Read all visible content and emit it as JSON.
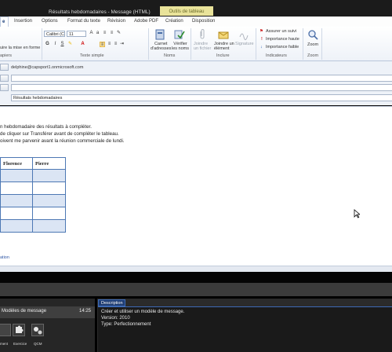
{
  "window": {
    "title": "Résultats hebdomadaires - Message (HTML)",
    "tools_tab": "Outils de tableau"
  },
  "tabs": [
    {
      "label": "e",
      "active": true
    },
    {
      "label": "Insertion"
    },
    {
      "label": "Options"
    },
    {
      "label": "Format du texte"
    },
    {
      "label": "Révision"
    },
    {
      "label": "Adobe PDF"
    },
    {
      "label": "Création"
    },
    {
      "label": "Disposition"
    }
  ],
  "ribbon": {
    "clipboard": {
      "format_painter": "uire la mise en forme",
      "label": "apiers"
    },
    "basic_text": {
      "font": "Calibri (C",
      "size": "11",
      "label": "Texte simple"
    },
    "names": {
      "address_book": "Carnet\nd'adresses",
      "check_names": "Vérifier\nles noms",
      "label": "Noms"
    },
    "include": {
      "attach_file": "Joindre\nun fichier",
      "attach_item": "Joindre un\nélément",
      "signature": "Signature",
      "label": "Inclure"
    },
    "tags": {
      "follow_up": "Assurer un suivi",
      "high": "Importance haute",
      "low": "Importance faible",
      "label": "Indicateurs"
    },
    "zoom": {
      "zoom": "Zoom",
      "label": "Zoom"
    }
  },
  "fields": {
    "from": "delphine@capsport1.onmicrosoft.com",
    "to": "",
    "cc": "",
    "subject": "Résultats hebdomadaires"
  },
  "body": {
    "lines": [
      "n hebdomadaire des résultats à compléter.",
      "de cliquer sur Transférer avant de compléter le tableau.",
      "oivent me parvenir avant la réunion commerciale de lundi."
    ],
    "table_headers": [
      "",
      "Florence",
      "Pierre"
    ],
    "signature": "ation"
  },
  "player": {
    "lesson_title": "Modèles de message",
    "lesson_time": "14:25",
    "tools": [
      {
        "caption": "ment",
        "icon": "document-icon"
      },
      {
        "caption": "Exercice",
        "icon": "puzzle-icon"
      },
      {
        "caption": "QCM",
        "icon": "gears-icon"
      }
    ],
    "description_tab": "Description",
    "description_lines": [
      "Créer et utiliser un modèle de message.",
      "Version: 2010",
      "Type: Perfectionnement"
    ]
  },
  "colors": {
    "accent": "#2e56a5",
    "table_border": "#4d78b4",
    "table_band": "#dbe5f4",
    "tools_tab": "#e9e39a"
  }
}
